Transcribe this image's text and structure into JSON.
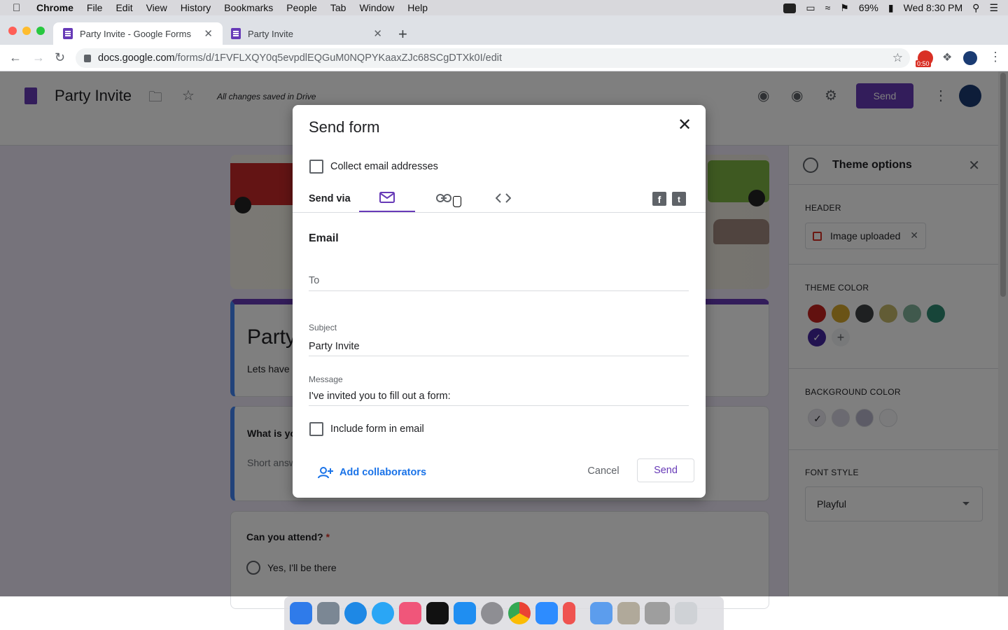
{
  "menubar": {
    "app": "Chrome",
    "items": [
      "File",
      "Edit",
      "View",
      "History",
      "Bookmarks",
      "People",
      "Tab",
      "Window",
      "Help"
    ],
    "battery": "69%",
    "clock": "Wed 8:30 PM"
  },
  "browser": {
    "tabs": [
      {
        "title": "Party Invite - Google Forms",
        "active": true
      },
      {
        "title": "Party Invite",
        "active": false
      }
    ],
    "url_host": "docs.google.com",
    "url_path": "/forms/d/1FVFLXQY0q5evpdlEQGuM0NQPYKaaxZJc68SCgDTXk0I/edit",
    "extension_badge": "0:50"
  },
  "form_page": {
    "title": "Party Invite",
    "save_status": "All changes saved in Drive",
    "send_label": "Send",
    "title_card_text": "Party",
    "title_card_desc": "Lets have",
    "question1": "What is you",
    "question1_hint": "Short answ",
    "question2": "Can you attend?",
    "required_mark": "*",
    "option1": "Yes,  I'll be there"
  },
  "theme_panel": {
    "title": "Theme options",
    "header_label": "HEADER",
    "header_chip": "Image uploaded",
    "theme_color_label": "THEME COLOR",
    "theme_colors": [
      "#c5221f",
      "#d4a72c",
      "#3c4043",
      "#c5b96b",
      "#81b29a",
      "#2e8b73",
      "#4527a0"
    ],
    "bg_color_label": "BACKGROUND COLOR",
    "bg_colors": [
      "#e8e6ef",
      "#d7d5e2",
      "#b8b6cc",
      "#f6f6f8"
    ],
    "font_style_label": "FONT STYLE",
    "font_style_value": "Playful"
  },
  "dialog": {
    "title": "Send form",
    "collect_email_label": "Collect email addresses",
    "send_via_label": "Send via",
    "section_heading": "Email",
    "to_placeholder": "To",
    "subject_label": "Subject",
    "subject_value": "Party Invite",
    "message_label": "Message",
    "message_value": "I've invited you to fill out a form:",
    "include_form_label": "Include form in email",
    "add_collaborators_label": "Add collaborators",
    "cancel_label": "Cancel",
    "send_label": "Send"
  },
  "colors": {
    "accent": "#673ab7",
    "link": "#1a73e8",
    "canvas_bg": "#ede7f6"
  }
}
